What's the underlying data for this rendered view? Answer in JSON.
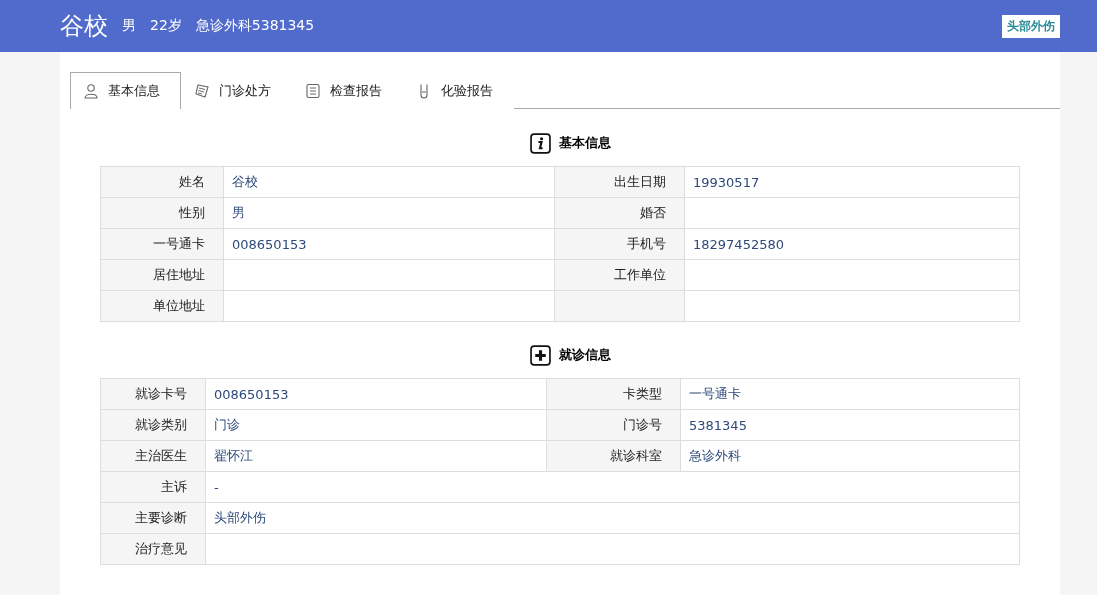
{
  "header": {
    "name": "谷校",
    "gender": "男",
    "age": "22岁",
    "visit": "急诊外科5381345",
    "tag": "头部外伤"
  },
  "tabs": [
    {
      "label": "基本信息",
      "kind": "person",
      "selected": true
    },
    {
      "label": "门诊处方",
      "kind": "prescription",
      "selected": false
    },
    {
      "label": "检查报告",
      "kind": "report",
      "selected": false
    },
    {
      "label": "化验报告",
      "kind": "tube",
      "selected": false
    }
  ],
  "basic_info": {
    "title": "基本信息",
    "rows": [
      {
        "kind": "pair",
        "label": "姓名",
        "value": "谷校",
        "label_2": "出生日期",
        "value_2": "19930517"
      },
      {
        "kind": "pair",
        "label": "性别",
        "value": "男",
        "label_2": "婚否"
      },
      {
        "kind": "pair",
        "label": "一号通卡",
        "value": "008650153",
        "label_2": "手机号",
        "value_2": "18297452580"
      },
      {
        "kind": "pair",
        "label": "居住地址",
        "label_2": "工作单位"
      },
      {
        "kind": "pair",
        "label": "单位地址"
      }
    ]
  },
  "visit_info": {
    "title": "就诊信息",
    "rows": [
      {
        "kind": "pair",
        "label": "就诊卡号",
        "value": "008650153",
        "label_2": "卡类型",
        "value_2": "一号通卡"
      },
      {
        "kind": "pair",
        "label": "就诊类别",
        "value": "门诊",
        "label_2": "门诊号",
        "value_2": "5381345"
      },
      {
        "kind": "pair",
        "label": "主治医生",
        "value": "翟怀江",
        "label_2": "就诊科室",
        "value_2": "急诊外科"
      },
      {
        "kind": "full",
        "label": "主诉",
        "value": "-"
      },
      {
        "kind": "full",
        "label": "主要诊断",
        "value": "头部外伤"
      },
      {
        "kind": "full",
        "label": "治疗意见"
      }
    ]
  }
}
